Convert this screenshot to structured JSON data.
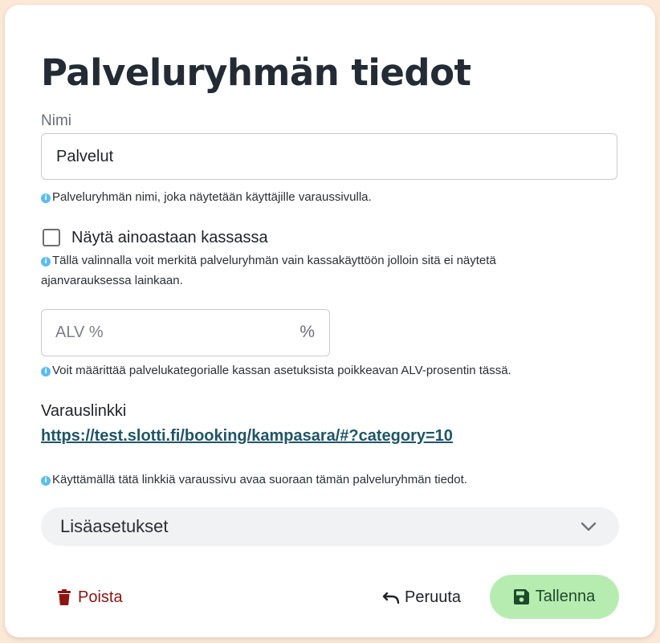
{
  "form": {
    "title": "Palveluryhmän tiedot",
    "name": {
      "label": "Nimi",
      "value": "Palvelut",
      "hint": "Palveluryhmän nimi, joka näytetään käyttäjille varaussivulla."
    },
    "cashier_only": {
      "label": "Näytä ainoastaan kassassa",
      "checked": false,
      "hint_line1": "Tällä valinnalla voit merkitä palveluryhmän vain kassakäyttöön jolloin sitä ei näytetä",
      "hint_line2": "ajanvarauksessa lainkaan."
    },
    "vat": {
      "placeholder": "ALV %",
      "value": "",
      "suffix": "%",
      "hint": "Voit määrittää palvelukategorialle kassan asetuksista poikkeavan ALV-prosentin tässä."
    },
    "booking_link": {
      "heading": "Varauslinkki",
      "url": "https://test.slotti.fi/booking/kampasara/#?category=10",
      "hint": "Käyttämällä tätä linkkiä varaussivu avaa suoraan tämän palveluryhmän tiedot."
    },
    "advanced": {
      "label": "Lisäasetukset",
      "icon": "chevron-down-icon"
    }
  },
  "actions": {
    "delete_label": "Poista",
    "cancel_label": "Peruuta",
    "save_label": "Tallenna"
  },
  "icons": {
    "info": "i"
  },
  "colors": {
    "page_background": "#fce8d6",
    "delete": "#8b1512",
    "save_background": "#b7ecb1",
    "link": "#1f5566",
    "info": "#5bbcf2"
  }
}
